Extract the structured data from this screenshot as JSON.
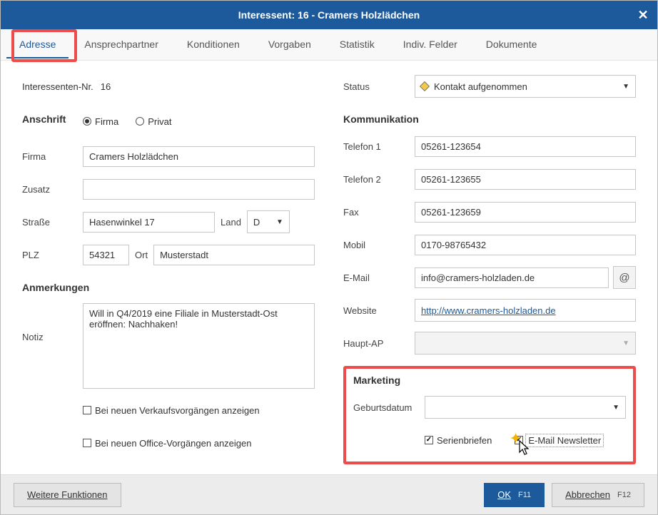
{
  "title": "Interessent: 16 - Cramers Holzlädchen",
  "tabs": [
    "Adresse",
    "Ansprechpartner",
    "Konditionen",
    "Vorgaben",
    "Statistik",
    "Indiv. Felder",
    "Dokumente"
  ],
  "left": {
    "interessent_nr_label": "Interessenten-Nr.",
    "interessent_nr": "16",
    "anschrift_title": "Anschrift",
    "radio_firma": "Firma",
    "radio_privat": "Privat",
    "firma_label": "Firma",
    "firma": "Cramers Holzlädchen",
    "zusatz_label": "Zusatz",
    "zusatz": "",
    "strasse_label": "Straße",
    "strasse": "Hasenwinkel 17",
    "land_label": "Land",
    "land": "D",
    "plz_label": "PLZ",
    "plz": "54321",
    "ort_label": "Ort",
    "ort": "Musterstadt",
    "anmerkungen_title": "Anmerkungen",
    "notiz_label": "Notiz",
    "notiz": "Will in Q4/2019 eine Filiale in Musterstadt-Ost eröffnen: Nachhaken!",
    "chk_verkauf": "Bei neuen Verkaufsvorgängen anzeigen",
    "chk_office": "Bei neuen Office-Vorgängen anzeigen"
  },
  "right": {
    "status_label": "Status",
    "status": "Kontakt aufgenommen",
    "komm_title": "Kommunikation",
    "tel1_label": "Telefon 1",
    "tel1": "05261-123654",
    "tel2_label": "Telefon 2",
    "tel2": "05261-123655",
    "fax_label": "Fax",
    "fax": "05261-123659",
    "mobil_label": "Mobil",
    "mobil": "0170-98765432",
    "email_label": "E-Mail",
    "email": "info@cramers-holzladen.de",
    "website_label": "Website",
    "website": "http://www.cramers-holzladen.de",
    "hauptap_label": "Haupt-AP",
    "marketing_title": "Marketing",
    "geb_label": "Geburtsdatum",
    "geb": "",
    "chk_serien": "Serienbriefen",
    "chk_newsletter": "E-Mail Newsletter"
  },
  "footer": {
    "more": "Weitere Funktionen",
    "ok": "OK",
    "ok_key": "F11",
    "cancel": "Abbrechen",
    "cancel_key": "F12"
  }
}
